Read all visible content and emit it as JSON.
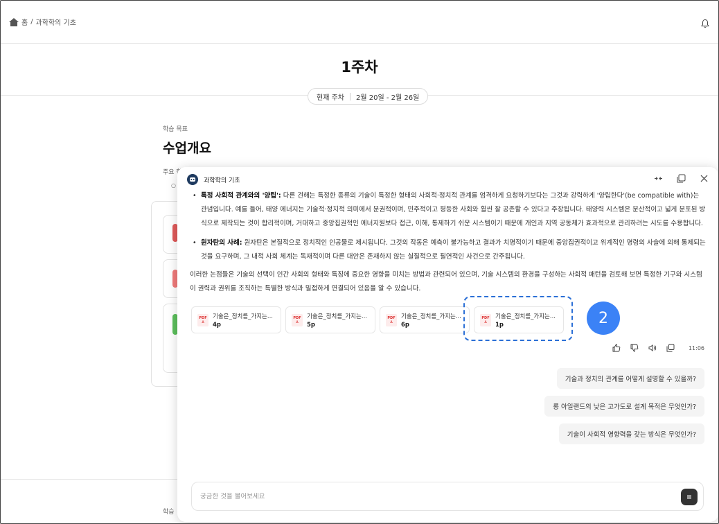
{
  "breadcrumb": {
    "home": "홈",
    "separator": "/",
    "current": "과학학의 기초"
  },
  "week": {
    "title": "1주차",
    "current_label": "현재 주차",
    "range": "2월 20일 - 2월 26일"
  },
  "section": {
    "label": "학습 목표",
    "title": "수업개요",
    "sub_label": "주요 학"
  },
  "bottom": {
    "label": "학습"
  },
  "chat": {
    "title": "과학학의 기초",
    "bullets": [
      {
        "bold": "특정 사회적 관계와의 '양립':",
        "text": " 다른 견해는 특정한 종류의 기술이 특정한 형태의 사회적·정치적 관계를 엄격하게 요청하기보다는 그것과 강력하게 '양립한다'(be compatible with)는 관념입니다. 예를 들어, 태양 에너지는 기술적·정치적 의미에서 분권적이며, 민주적이고 평등한 사회와 훨씬 잘 공존할 수 있다고 주장됩니다. 태양력 시스템은 분산적이고 넓게 분포된 방식으로 제작되는 것이 합리적이며, 거대하고 중앙집권적인 에너지원보다 접근, 이해, 통제하기 쉬운 시스템이기 때문에 개인과 지역 공동체가 효과적으로 관리하려는 시도를 수용합니다."
      },
      {
        "bold": "원자탄의 사례:",
        "text": " 원자탄은 본질적으로 정치적인 인공물로 제시됩니다. 그것의 작동은 예측이 불가능하고 결과가 치명적이기 때문에 중앙집권적이고 위계적인 명령의 사슬에 의해 통제되는 것을 요구하며, 그 내적 사회 체계는 독재적이며 다른 대안은 존재하지 않는 실질적으로 필연적인 사건으로 간주됩니다."
      }
    ],
    "summary": "이러한 논점들은 기술의 선택이 인간 사회의 형태와 특징에 중요한 영향을 미치는 방법과 관련되어 있으며, 기술 시스템의 환경을 구성하는 사회적 패턴을 검토해 보면 특정한 기구와 시스템이 권력과 권위를 조직하는 특별한 방식과 밀접하게 연결되어 있음을 알 수 있습니다.",
    "sources": [
      {
        "title": "기술은_정치를_가지는...",
        "page": "4p"
      },
      {
        "title": "기술은_정치를_가지는...",
        "page": "5p"
      },
      {
        "title": "기술은_정치를_가지는...",
        "page": "6p"
      },
      {
        "title": "기술은_정치를_가지는...",
        "page": "1p"
      }
    ],
    "pdf_badge": "PDF",
    "step_number": "2",
    "time": "11:06",
    "suggestions": [
      "기술과 정치의 관계를 어떻게 설명할 수 있을까?",
      "롱 아일랜드의 낮은 고가도로 설계 목적은 무엇인가?",
      "기술이 사회적 영향력을 갖는 방식은 무엇인가?"
    ],
    "input_placeholder": "궁금한 것을 물어보세요"
  },
  "colors": {
    "accent": "#3b82f6",
    "highlight_border": "#2b6fd6",
    "pdf_red": "#d33333"
  },
  "icons": [
    "home-icon",
    "bell-icon",
    "bot-avatar-icon",
    "collapse-icon",
    "open-window-icon",
    "close-icon",
    "pdf-icon",
    "thumbs-up-icon",
    "thumbs-down-icon",
    "speaker-icon",
    "copy-icon",
    "menu-icon"
  ]
}
